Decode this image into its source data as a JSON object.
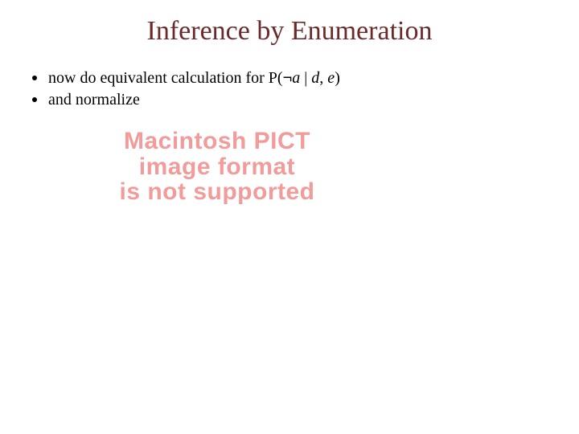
{
  "title": "Inference by Enumeration",
  "bullets": [
    {
      "prefix": "now do equivalent calculation for P(",
      "neg": "¬",
      "var1": "a",
      "mid": " | ",
      "var2": "d",
      "sep": ", ",
      "var3": "e",
      "suffix": ")"
    },
    {
      "text": "and normalize"
    }
  ],
  "warning": {
    "line1": "Macintosh PICT",
    "line2": "image format",
    "line3": "is not supported"
  }
}
